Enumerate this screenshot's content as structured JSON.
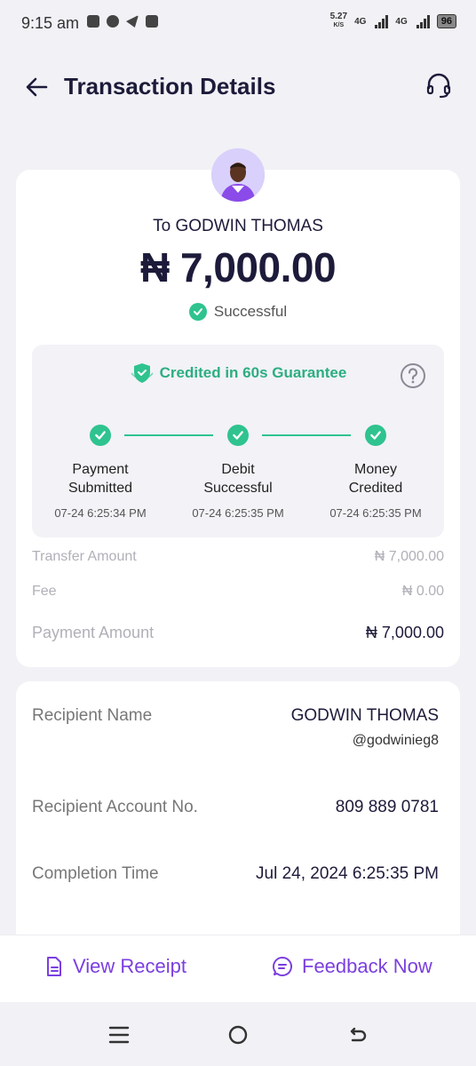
{
  "status_bar": {
    "time": "9:15 am",
    "speed_value": "5.27",
    "speed_unit": "K/S",
    "network1": "4G",
    "network2": "4G",
    "battery": "96"
  },
  "header": {
    "title": "Transaction Details"
  },
  "summary": {
    "recipient_line": "To GODWIN THOMAS",
    "amount": "₦ 7,000.00",
    "status": "Successful"
  },
  "guarantee": {
    "title": "Credited in 60s Guarantee",
    "steps": [
      {
        "label_line1": "Payment",
        "label_line2": "Submitted",
        "time": "07-24 6:25:34 PM"
      },
      {
        "label_line1": "Debit",
        "label_line2": "Successful",
        "time": "07-24 6:25:35 PM"
      },
      {
        "label_line1": "Money",
        "label_line2": "Credited",
        "time": "07-24 6:25:35 PM"
      }
    ]
  },
  "amounts": {
    "transfer_label": "Transfer Amount",
    "transfer_value": "₦ 7,000.00",
    "fee_label": "Fee",
    "fee_value": "₦ 0.00",
    "payment_label": "Payment Amount",
    "payment_value": "₦ 7,000.00"
  },
  "details": {
    "recipient_name_label": "Recipient Name",
    "recipient_name_value": "GODWIN THOMAS",
    "recipient_handle": "@godwinieg8",
    "account_label": "Recipient Account No.",
    "account_value": "809 889 0781",
    "completion_label": "Completion Time",
    "completion_value": "Jul 24, 2024 6:25:35 PM"
  },
  "actions": {
    "view_receipt": "View Receipt",
    "feedback": "Feedback Now"
  },
  "colors": {
    "accent_green": "#2fc38f",
    "accent_purple": "#7a3fe0",
    "primary_text": "#1d1b3a"
  }
}
